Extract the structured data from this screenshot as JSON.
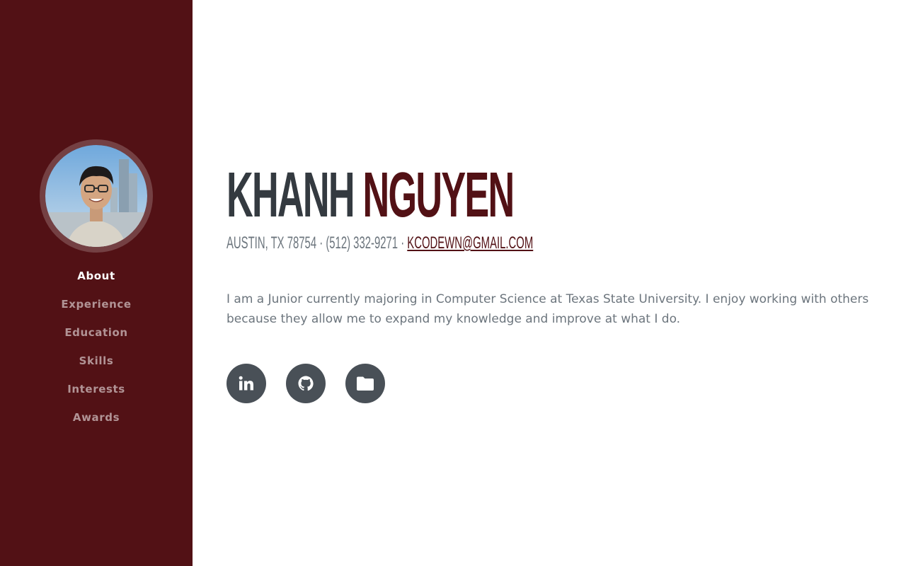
{
  "sidebar": {
    "avatar_icon": "profile-photo",
    "nav": [
      {
        "label": "About",
        "active": true
      },
      {
        "label": "Experience",
        "active": false
      },
      {
        "label": "Education",
        "active": false
      },
      {
        "label": "Skills",
        "active": false
      },
      {
        "label": "Interests",
        "active": false
      },
      {
        "label": "Awards",
        "active": false
      }
    ]
  },
  "header": {
    "first_name": "KHANH",
    "last_name": "NGUYEN",
    "address_phone": "AUSTIN, TX 78754 · (512) 332-9271 · ",
    "email": "KCODEWN@GMAIL.COM"
  },
  "about": {
    "text": "I am a Junior currently majoring in Computer Science at Texas State University. I enjoy working with others because they allow me to expand my knowledge and improve at what I do."
  },
  "social": [
    {
      "icon": "linkedin-icon"
    },
    {
      "icon": "github-icon"
    },
    {
      "icon": "folder-icon"
    }
  ],
  "colors": {
    "sidebar_bg": "#521115",
    "accent": "#521115",
    "heading": "#343a40",
    "muted": "#6c757d",
    "social_bg": "#495057"
  }
}
